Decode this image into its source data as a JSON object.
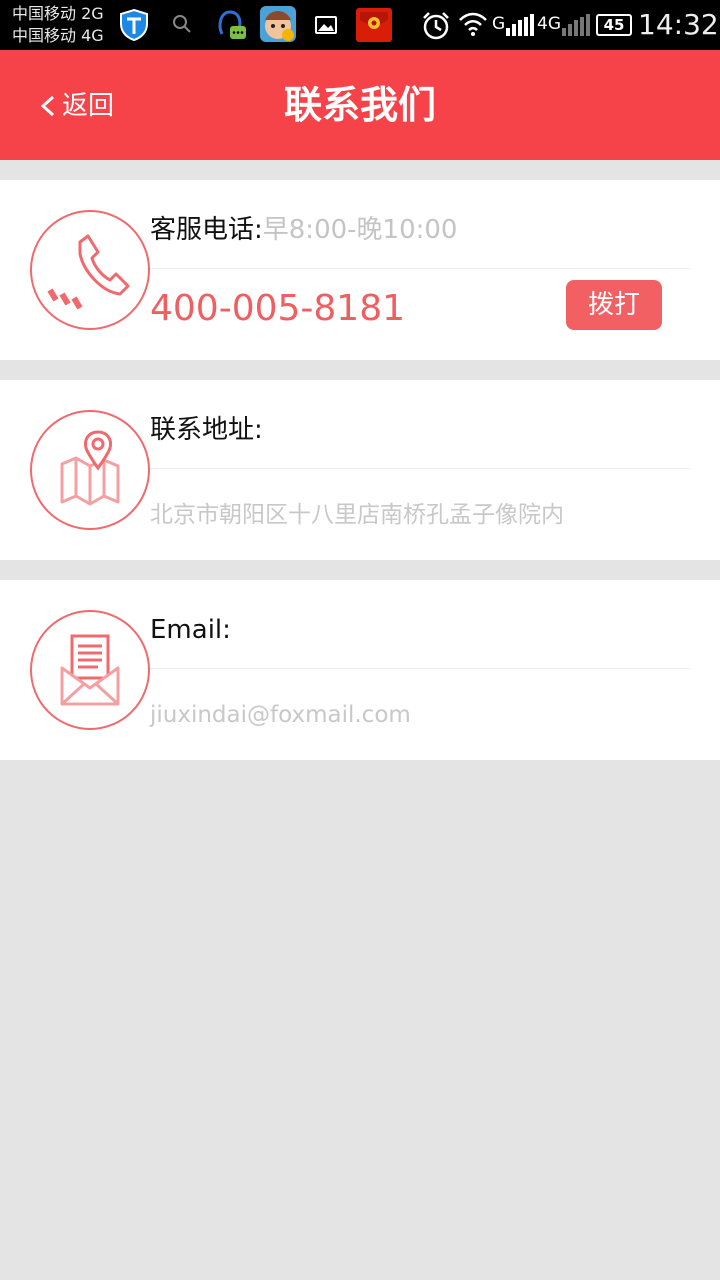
{
  "status_bar": {
    "carrier_1": "中国移动 2G",
    "carrier_2": "中国移动 4G",
    "network_1": "G",
    "network_2": "4G",
    "battery": "45",
    "time": "14:32"
  },
  "header": {
    "back_label": "返回",
    "title": "联系我们",
    "background_color": "#f64349"
  },
  "cards": {
    "phone": {
      "label": "客服电话:",
      "hours": "早8:00-晚10:00",
      "number": "400-005-8181",
      "dial_label": "拨打",
      "icon": "phone-icon"
    },
    "address": {
      "label": "联系地址:",
      "value": "北京市朝阳区十八里店南桥孔孟子像院内",
      "icon": "map-pin-icon"
    },
    "email": {
      "label": "Email:",
      "value": "jiuxindai@foxmail.com",
      "icon": "envelope-icon"
    }
  },
  "colors": {
    "accent": "#f36064",
    "icon_stroke": "#f06a6d",
    "muted_text": "#c4c4c4",
    "page_background": "#e4e4e4"
  }
}
